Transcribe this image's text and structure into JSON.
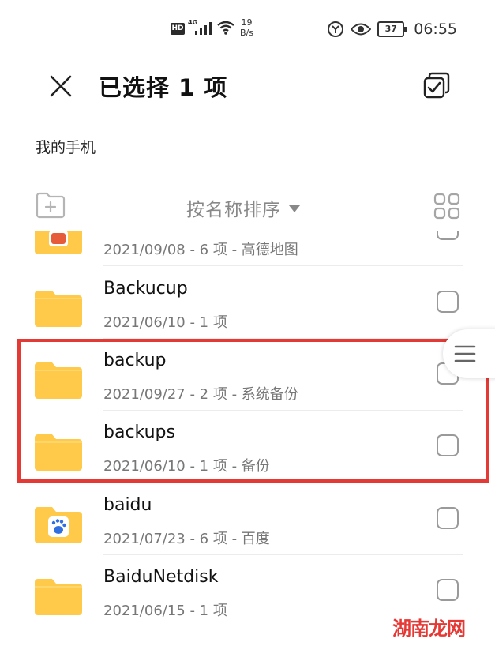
{
  "status_bar": {
    "hd": "HD",
    "network": "4G",
    "speed_value": "19",
    "speed_unit": "B/s",
    "battery": "37",
    "time": "06:55"
  },
  "header": {
    "title": "已选择 1 项",
    "breadcrumb": "我的手机"
  },
  "toolbar": {
    "sort_label": "按名称排序"
  },
  "files": [
    {
      "name": "",
      "meta": "2021/09/08 - 6 项 - 高德地图",
      "icon": "folder-amap-icon",
      "checked": false
    },
    {
      "name": "Backucup",
      "meta": "2021/06/10 - 1 项",
      "icon": "folder-icon",
      "checked": false
    },
    {
      "name": "backup",
      "meta": "2021/09/27 - 2 项 - 系统备份",
      "icon": "folder-icon",
      "checked": false
    },
    {
      "name": "backups",
      "meta": "2021/06/10 - 1 项 - 备份",
      "icon": "folder-icon",
      "checked": false
    },
    {
      "name": "baidu",
      "meta": "2021/07/23 - 6 项 - 百度",
      "icon": "folder-baidu-icon",
      "checked": false
    },
    {
      "name": "BaiduNetdisk",
      "meta": "2021/06/15 - 1 项",
      "icon": "folder-icon",
      "checked": false
    }
  ],
  "watermark": "湖南龙网",
  "colors": {
    "folder": "#FFC94A",
    "highlight": "#E53935",
    "accent_text": "#888888"
  }
}
